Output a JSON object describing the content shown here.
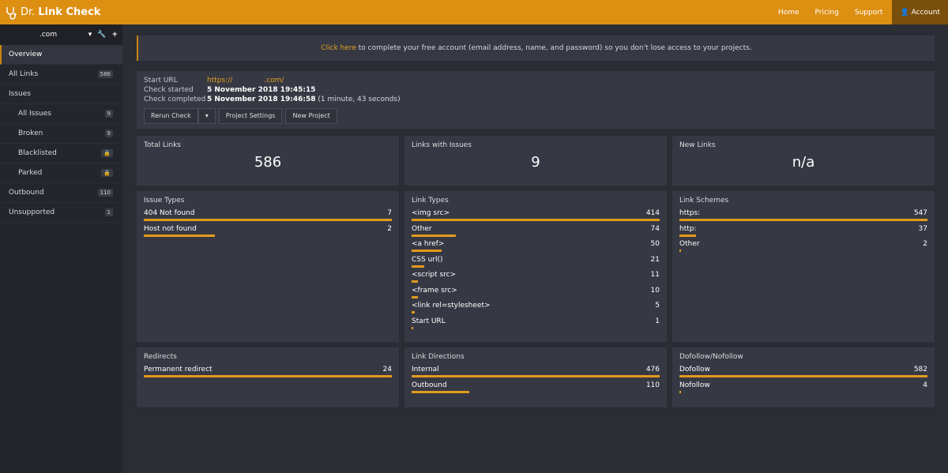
{
  "header": {
    "brand_prefix": "Dr.",
    "brand_name": "Link Check",
    "nav": [
      "Home",
      "Pricing",
      "Support"
    ],
    "account": "Account",
    "accent": "#dd8f12"
  },
  "sidebar": {
    "project": ".com",
    "items": [
      {
        "label": "Overview",
        "active": true
      },
      {
        "label": "All Links",
        "badge": "586"
      },
      {
        "label": "Issues"
      },
      {
        "label": "All Issues",
        "badge": "9",
        "sub": true
      },
      {
        "label": "Broken",
        "badge": "9",
        "sub": true
      },
      {
        "label": "Blacklisted",
        "badge": "🔒",
        "sub": true
      },
      {
        "label": "Parked",
        "badge": "🔒",
        "sub": true
      },
      {
        "label": "Outbound",
        "badge": "110"
      },
      {
        "label": "Unsupported",
        "badge": "1"
      }
    ]
  },
  "banner": {
    "link": "Click here",
    "text": " to complete your free account (email address, name, and password) so you don't lose access to your projects."
  },
  "info": {
    "start_url_label": "Start URL",
    "start_url": "https://              .com/",
    "started_label": "Check started",
    "started": "5 November 2018 19:45:15",
    "completed_label": "Check completed",
    "completed": "5 November 2018 19:46:58",
    "duration": "(1 minute, 43 seconds)",
    "buttons": {
      "rerun": "Rerun Check",
      "settings": "Project Settings",
      "new": "New Project"
    }
  },
  "stats": [
    {
      "title": "Total Links",
      "value": "586"
    },
    {
      "title": "Links with Issues",
      "value": "9"
    },
    {
      "title": "New Links",
      "value": "n/a"
    }
  ],
  "lists": [
    {
      "title": "Issue Types",
      "items": [
        {
          "label": "404 Not found",
          "value": 7
        },
        {
          "label": "Host not found",
          "value": 2
        }
      ]
    },
    {
      "title": "Link Types",
      "items": [
        {
          "label": "<img src>",
          "value": 414
        },
        {
          "label": "Other",
          "value": 74
        },
        {
          "label": "<a href>",
          "value": 50
        },
        {
          "label": "CSS url()",
          "value": 21
        },
        {
          "label": "<script src>",
          "value": 11
        },
        {
          "label": "<frame src>",
          "value": 10
        },
        {
          "label": "<link rel=stylesheet>",
          "value": 5
        },
        {
          "label": "Start URL",
          "value": 1
        }
      ]
    },
    {
      "title": "Link Schemes",
      "items": [
        {
          "label": "https:",
          "value": 547
        },
        {
          "label": "http:",
          "value": 37
        },
        {
          "label": "Other",
          "value": 2
        }
      ]
    },
    {
      "title": "Redirects",
      "items": [
        {
          "label": "Permanent redirect",
          "value": 24
        }
      ]
    },
    {
      "title": "Link Directions",
      "items": [
        {
          "label": "Internal",
          "value": 476
        },
        {
          "label": "Outbound",
          "value": 110
        }
      ]
    },
    {
      "title": "Dofollow/Nofollow",
      "items": [
        {
          "label": "Dofollow",
          "value": 582
        },
        {
          "label": "Nofollow",
          "value": 4
        }
      ]
    }
  ]
}
